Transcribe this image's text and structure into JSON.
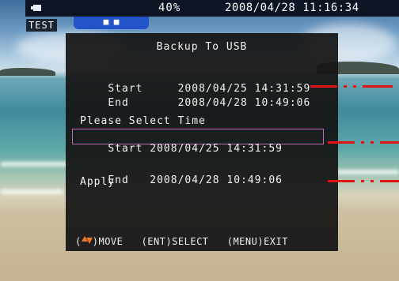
{
  "status_bar": {
    "battery_icon": "battery-icon",
    "battery_percent": "40%",
    "datetime": "2008/04/28 11:16:34"
  },
  "camera_label": "TEST",
  "dialog": {
    "title": "Backup To USB",
    "range_start_label": "Start",
    "range_start_value": "2008/04/25 14:31:59",
    "range_end_label": "End",
    "range_end_value": "2008/04/28 10:49:06",
    "prompt": "Please Select Time",
    "select_start_label": "Start",
    "select_start_value": "2008/04/25 14:31:59",
    "select_end_label": "End",
    "select_end_value": "2008/04/28 10:49:06",
    "apply_label": "Apply",
    "footer": {
      "move_icon": "up-down-arrow-icon",
      "move_label": "MOVE",
      "select_label": "(ENT)SELECT",
      "exit_label": "(MENU)EXIT"
    }
  },
  "colors": {
    "status_bar_bg": "#0d1424",
    "dialog_bg": "#141414",
    "selection_border": "#c06ab5",
    "annotation_red": "#e01414",
    "arrow_orange": "#e87a2a"
  }
}
